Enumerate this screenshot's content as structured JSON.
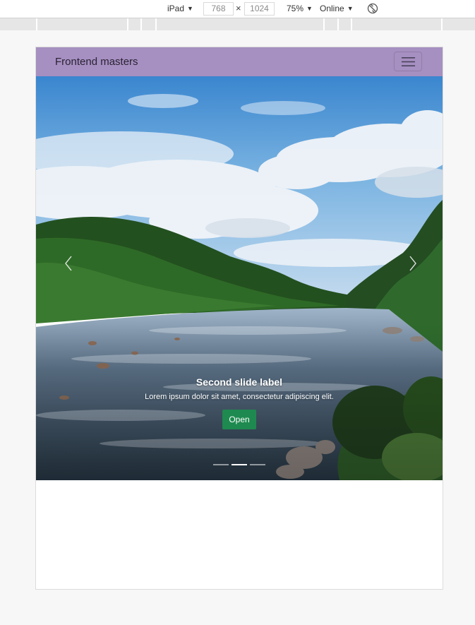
{
  "devtools": {
    "device": "iPad",
    "width": "768",
    "height": "1024",
    "times": "×",
    "zoom": "75%",
    "network": "Online"
  },
  "navbar": {
    "brand": "Frontend masters",
    "color": "#a68fc1"
  },
  "carousel": {
    "active_slide": 2,
    "slide_count": 3,
    "caption": {
      "title": "Second slide label",
      "text": "Lorem ipsum dolor sit amet, consectetur adipiscing elit.",
      "button": "Open"
    },
    "button_color": "#1e8a4f",
    "prev_icon": "chevron-left-icon",
    "next_icon": "chevron-right-icon"
  }
}
